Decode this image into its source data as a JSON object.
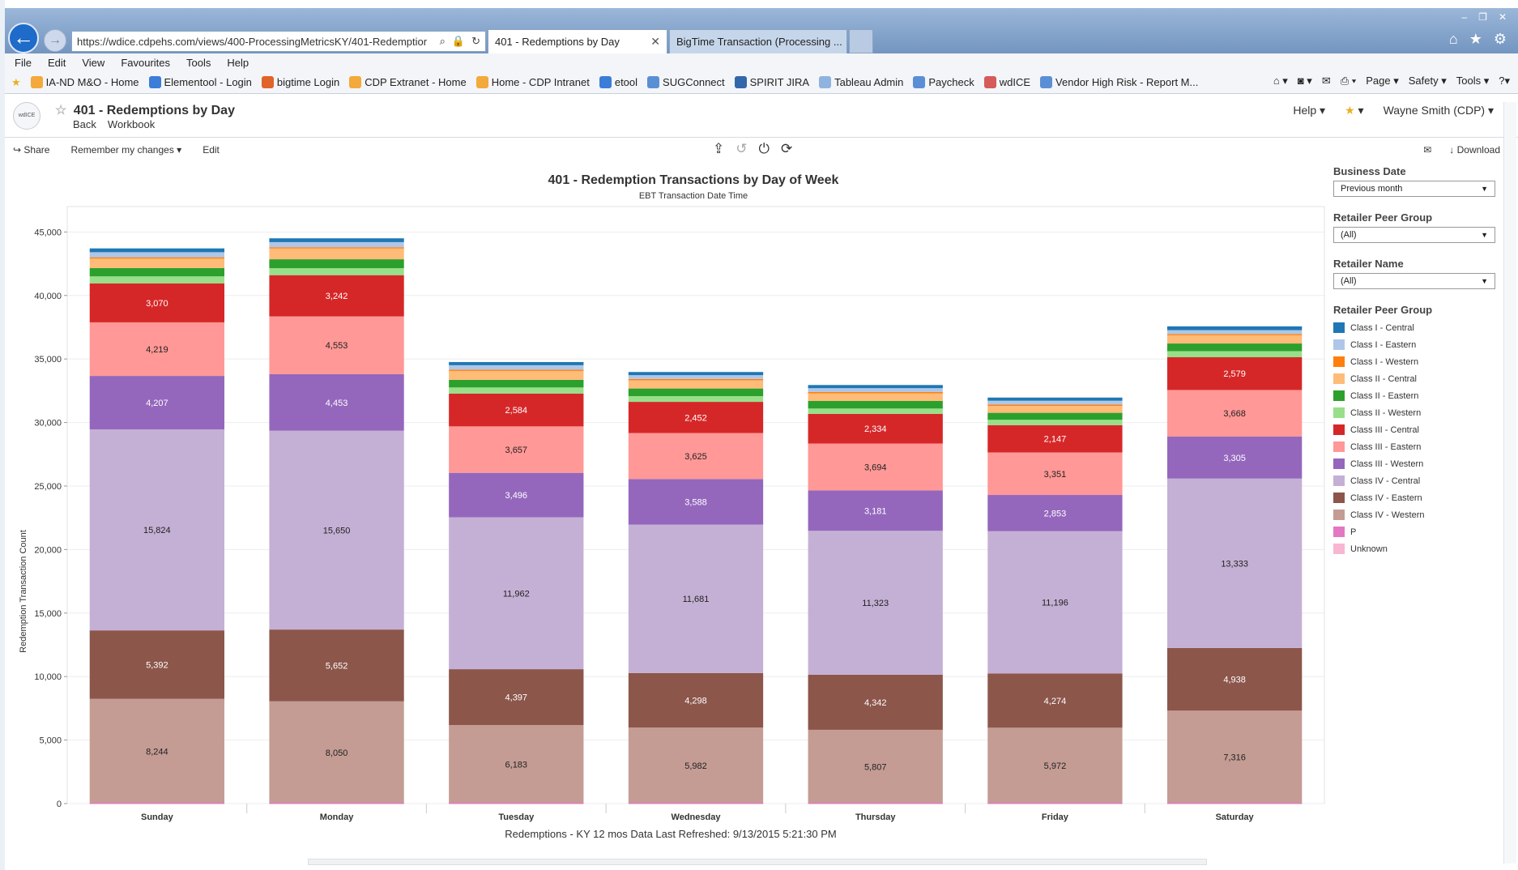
{
  "browser": {
    "url": "https://wdice.cdpehs.com/views/400-ProcessingMetricsKY/401-Redemptior",
    "tabs": [
      {
        "label": "401 - Redemptions by Day",
        "active": true
      },
      {
        "label": "BigTime Transaction (Processing ...",
        "active": false
      }
    ],
    "menu": [
      "File",
      "Edit",
      "View",
      "Favourites",
      "Tools",
      "Help"
    ],
    "favourites": [
      {
        "label": "IA-ND M&O - Home",
        "color": "#f3a93b"
      },
      {
        "label": "Elementool - Login",
        "color": "#3b7dd8"
      },
      {
        "label": "bigtime Login",
        "color": "#e0632a"
      },
      {
        "label": "CDP Extranet - Home",
        "color": "#f3a93b"
      },
      {
        "label": "Home - CDP Intranet",
        "color": "#f3a93b"
      },
      {
        "label": "etool",
        "color": "#3b7dd8"
      },
      {
        "label": "SUGConnect",
        "color": "#5a8fd6"
      },
      {
        "label": "SPIRIT JIRA",
        "color": "#3366aa"
      },
      {
        "label": "Tableau Admin",
        "color": "#8fb3de"
      },
      {
        "label": "Paycheck",
        "color": "#5a8fd6"
      },
      {
        "label": "wdICE",
        "color": "#d65a5a"
      },
      {
        "label": "Vendor High Risk - Report M...",
        "color": "#5a8fd6"
      }
    ],
    "commands": [
      "Page ▾",
      "Safety ▾",
      "Tools ▾"
    ]
  },
  "app": {
    "logo_text": "wdICE",
    "page_title": "401 - Redemptions by Day",
    "back_label": "Back",
    "workbook_label": "Workbook",
    "help_label": "Help ▾",
    "user_label": "Wayne Smith (CDP) ▾",
    "share_label": "Share",
    "remember_label": "Remember my changes ▾",
    "edit_label": "Edit",
    "download_label": "Download"
  },
  "filters": [
    {
      "label": "Business Date",
      "value": "Previous month"
    },
    {
      "label": "Retailer Peer Group",
      "value": "(All)"
    },
    {
      "label": "Retailer Name",
      "value": "(All)"
    }
  ],
  "legend_title": "Retailer Peer Group",
  "chart_data": {
    "type": "bar",
    "stacked": true,
    "title": "401 - Redemption Transactions by Day of Week",
    "subtitle": "EBT Transaction Date Time",
    "xlabel": "",
    "ylabel": "Redemption Transaction Count",
    "ylim": [
      0,
      47000
    ],
    "yticks": [
      0,
      5000,
      10000,
      15000,
      20000,
      25000,
      30000,
      35000,
      40000,
      45000
    ],
    "ytick_labels": [
      "0",
      "5,000",
      "10,000",
      "15,000",
      "20,000",
      "25,000",
      "30,000",
      "35,000",
      "40,000",
      "45,000"
    ],
    "categories": [
      "Sunday",
      "Monday",
      "Tuesday",
      "Wednesday",
      "Thursday",
      "Friday",
      "Saturday"
    ],
    "footer": "Redemptions - KY 12 mos Data Last Refreshed: 9/13/2015 5:21:30 PM",
    "series": [
      {
        "name": "Class IV - Western",
        "color": "#c49c94",
        "values": [
          8244,
          8050,
          6183,
          5982,
          5807,
          5972,
          7316
        ],
        "labels": [
          "8,244",
          "8,050",
          "6,183",
          "5,982",
          "5,807",
          "5,972",
          "7,316"
        ]
      },
      {
        "name": "Class IV - Eastern",
        "color": "#8c564b",
        "values": [
          5392,
          5652,
          4397,
          4298,
          4342,
          4274,
          4938
        ],
        "labels": [
          "5,392",
          "5,652",
          "4,397",
          "4,298",
          "4,342",
          "4,274",
          "4,938"
        ]
      },
      {
        "name": "Class IV - Central",
        "color": "#c5b0d5",
        "values": [
          15824,
          15650,
          11962,
          11681,
          11323,
          11196,
          13333
        ],
        "labels": [
          "15,824",
          "15,650",
          "11,962",
          "11,681",
          "11,323",
          "11,196",
          "13,333"
        ]
      },
      {
        "name": "Class III - Western",
        "color": "#9467bd",
        "values": [
          4207,
          4453,
          3496,
          3588,
          3181,
          2853,
          3305
        ],
        "labels": [
          "4,207",
          "4,453",
          "3,496",
          "3,588",
          "3,181",
          "2,853",
          "3,305"
        ]
      },
      {
        "name": "Class III - Eastern",
        "color": "#ff9896",
        "values": [
          4219,
          4553,
          3657,
          3625,
          3694,
          3351,
          3668
        ],
        "labels": [
          "4,219",
          "4,553",
          "3,657",
          "3,625",
          "3,694",
          "3,351",
          "3,668"
        ]
      },
      {
        "name": "Class III - Central",
        "color": "#d62728",
        "values": [
          3070,
          3242,
          2584,
          2452,
          2334,
          2147,
          2579
        ],
        "labels": [
          "3,070",
          "3,242",
          "2,584",
          "2,452",
          "2,334",
          "2,147",
          "2,579"
        ]
      },
      {
        "name": "Class II - Western",
        "color": "#98df8a",
        "values": [
          550,
          550,
          480,
          450,
          420,
          420,
          480
        ],
        "labels": [
          "",
          "",
          "",
          "",
          "",
          "",
          ""
        ]
      },
      {
        "name": "Class II - Eastern",
        "color": "#2ca02c",
        "values": [
          650,
          700,
          600,
          600,
          600,
          550,
          600
        ],
        "labels": [
          "",
          "",
          "",
          "",
          "",
          "",
          ""
        ]
      },
      {
        "name": "Class II - Central",
        "color": "#ffbb78",
        "values": [
          750,
          850,
          700,
          650,
          600,
          550,
          650
        ],
        "labels": [
          "",
          "",
          "",
          "",
          "",
          "",
          ""
        ]
      },
      {
        "name": "Class I - Western",
        "color": "#ff7f0e",
        "values": [
          100,
          100,
          100,
          100,
          100,
          100,
          100
        ],
        "labels": [
          "",
          "",
          "",
          "",
          "",
          "",
          ""
        ]
      },
      {
        "name": "Class I - Eastern",
        "color": "#aec7e8",
        "values": [
          400,
          400,
          350,
          300,
          300,
          300,
          300
        ],
        "labels": [
          "",
          "",
          "",
          "",
          "",
          "",
          ""
        ]
      },
      {
        "name": "Class I - Central",
        "color": "#1f77b4",
        "values": [
          300,
          300,
          250,
          250,
          250,
          250,
          300
        ],
        "labels": [
          "",
          "",
          "",
          "",
          "",
          "",
          ""
        ]
      },
      {
        "name": "P",
        "color": "#e377c2",
        "values": [
          0,
          0,
          0,
          0,
          0,
          0,
          0
        ],
        "labels": [
          "",
          "",
          "",
          "",
          "",
          "",
          ""
        ]
      },
      {
        "name": "Unknown",
        "color": "#f7b6d2",
        "values": [
          0,
          0,
          0,
          0,
          0,
          0,
          0
        ],
        "labels": [
          "",
          "",
          "",
          "",
          "",
          "",
          ""
        ]
      }
    ],
    "legend_order": [
      "Class I - Central",
      "Class I - Eastern",
      "Class I - Western",
      "Class II - Central",
      "Class II - Eastern",
      "Class II - Western",
      "Class III - Central",
      "Class III - Eastern",
      "Class III - Western",
      "Class IV - Central",
      "Class IV - Eastern",
      "Class IV - Western",
      "P",
      "Unknown"
    ],
    "legend_placement": "right"
  }
}
